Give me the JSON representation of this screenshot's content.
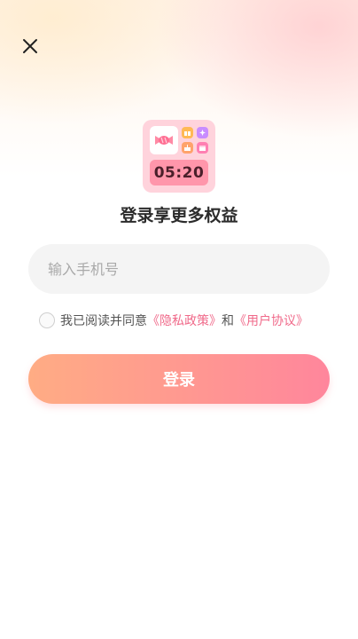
{
  "header": {
    "close_icon": "close-icon"
  },
  "app_icon": {
    "clock_time": "05:20",
    "tiles": [
      "candy-icon",
      "gift-icon",
      "star-icon",
      "cake-icon",
      "calendar-icon"
    ]
  },
  "title": "登录享更多权益",
  "phone": {
    "placeholder": "输入手机号",
    "value": ""
  },
  "agreement": {
    "prefix": "我已阅读并同意",
    "privacy_link": "《隐私政策》",
    "joiner": "和",
    "user_link": "《用户协议》",
    "checked": false
  },
  "login_button": {
    "label": "登录"
  },
  "colors": {
    "accent": "#f06a8a",
    "button_start": "#ffac84",
    "button_end": "#ff869c",
    "icon_bg": "#ffd3dc"
  }
}
